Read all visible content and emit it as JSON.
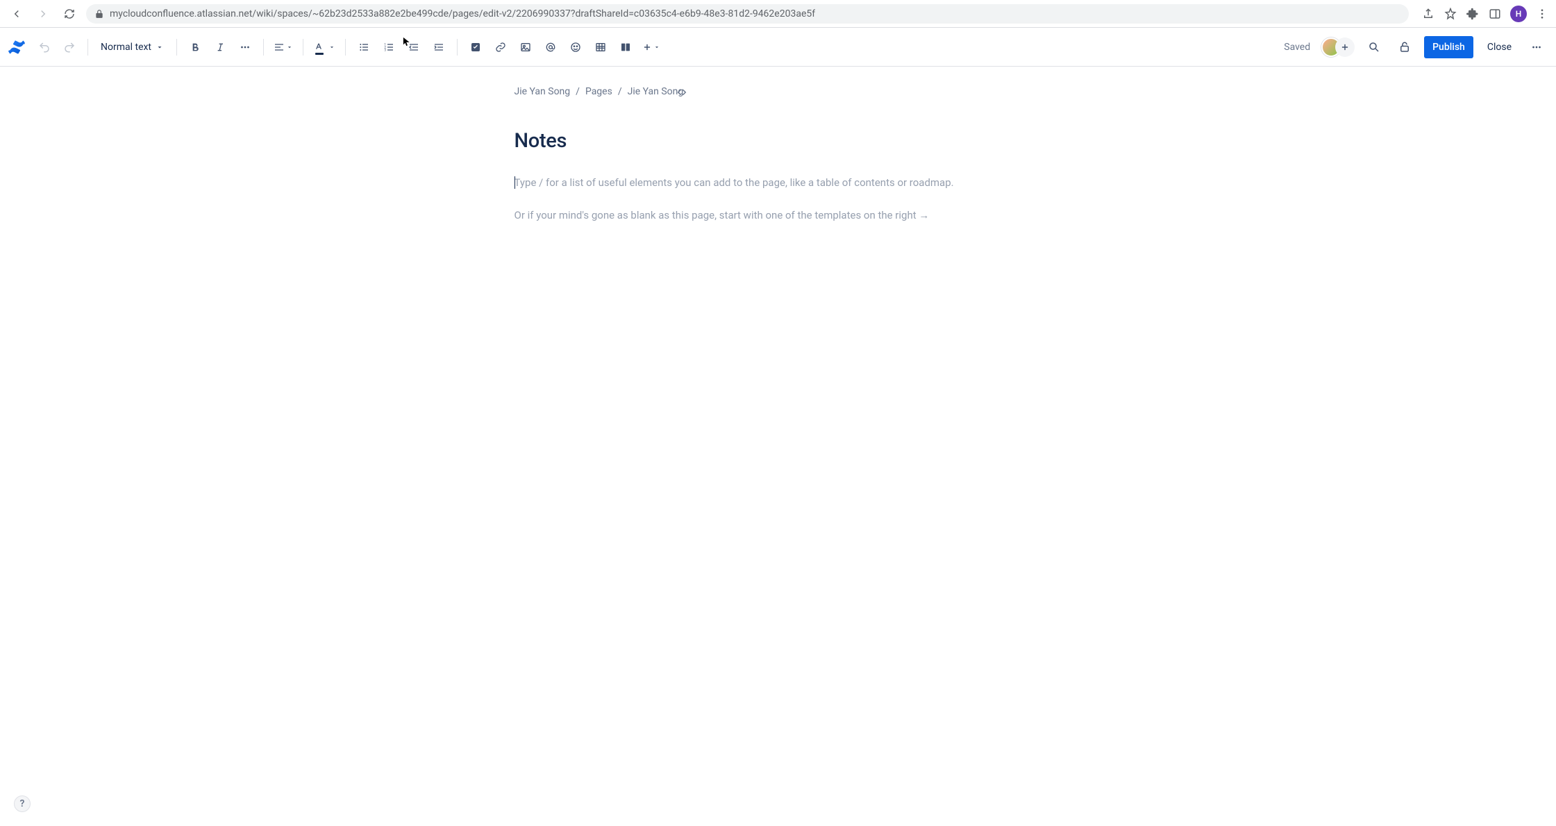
{
  "browser": {
    "url": "mycloudconfluence.atlassian.net/wiki/spaces/~62b23d2533a882e2be499cde/pages/edit-v2/2206990337?draftShareId=c03635c4-e6b9-48e3-81d2-9462e203ae5f",
    "avatar_initial": "H"
  },
  "toolbar": {
    "style_label": "Normal text",
    "saved_label": "Saved",
    "publish_label": "Publish",
    "close_label": "Close"
  },
  "breadcrumbs": {
    "items": [
      "Jie Yan Song",
      "Pages",
      "Jie Yan Song"
    ],
    "separator": "/"
  },
  "page": {
    "title": "Notes",
    "hint_primary": "Type / for a list of useful elements you can add to the page, like a table of contents or roadmap.",
    "hint_secondary": "Or if your mind's gone as blank as this page, start with one of the templates on the right →"
  },
  "help": {
    "label": "?"
  }
}
